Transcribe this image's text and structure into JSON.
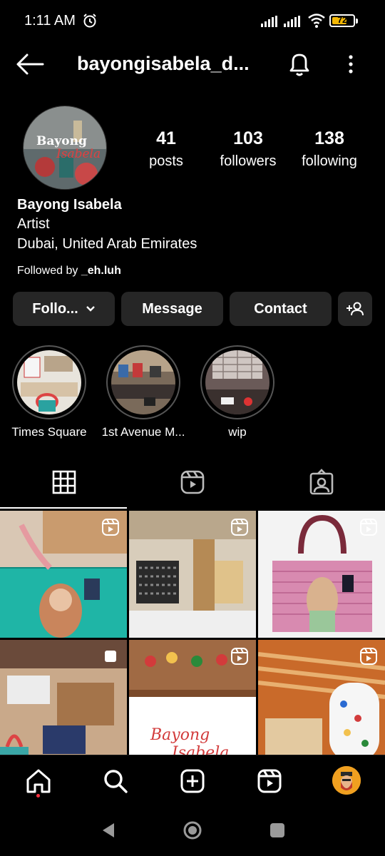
{
  "status": {
    "time": "1:11 AM",
    "battery": "72",
    "battery_level": 0.72
  },
  "header": {
    "username": "bayongisabela_d..."
  },
  "profile": {
    "name": "Bayong Isabela",
    "category": "Artist",
    "location": "Dubai, United Arab Emirates",
    "followed_prefix": "Followed by ",
    "followed_user": "_eh.luh",
    "avatar_text_1": "Bayong",
    "avatar_text_2": "Isabela",
    "stats": [
      {
        "num": "41",
        "label": "posts"
      },
      {
        "num": "103",
        "label": "followers"
      },
      {
        "num": "138",
        "label": "following"
      }
    ]
  },
  "buttons": {
    "follow": "Follo...",
    "message": "Message",
    "contact": "Contact"
  },
  "highlights": [
    {
      "label": "Times Square"
    },
    {
      "label": "1st Avenue M..."
    },
    {
      "label": "wip"
    }
  ],
  "tabs": [
    "grid",
    "reels",
    "tagged"
  ],
  "posts": [
    {
      "type": "reel",
      "colors": [
        "#1fb5a6",
        "#e9d7c4",
        "#c9855c"
      ]
    },
    {
      "type": "reel",
      "colors": [
        "#d8cdbb",
        "#2a2a2a",
        "#b58a55"
      ]
    },
    {
      "type": "reel",
      "colors": [
        "#f3f3f3",
        "#d88ab0",
        "#7a2a3a"
      ]
    },
    {
      "type": "post",
      "colors": [
        "#c9a98a",
        "#6a4a3a",
        "#3aa6a6"
      ]
    },
    {
      "type": "reel",
      "colors": [
        "#7b4a2a",
        "#ffffff",
        "#d23b3b"
      ]
    },
    {
      "type": "reel",
      "colors": [
        "#c96a2a",
        "#f6f6f6",
        "#2a6ad2"
      ]
    }
  ],
  "colors": {
    "background": "#000000",
    "button_bg": "#262626",
    "notification_dot": "#ff3040",
    "battery": "#f2b705"
  }
}
